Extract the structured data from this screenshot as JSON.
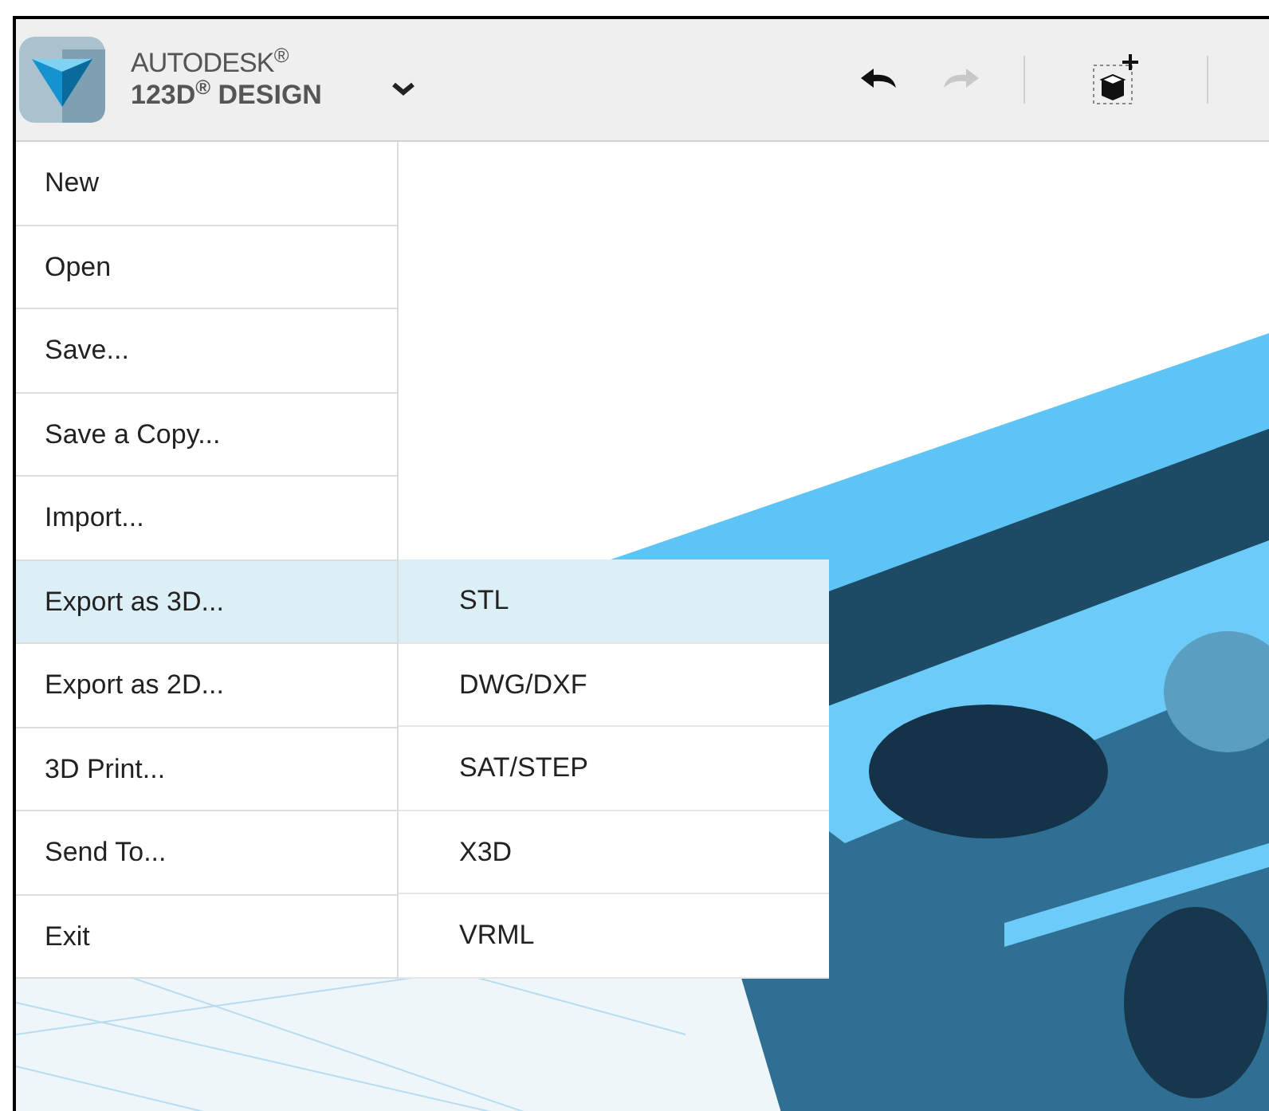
{
  "app": {
    "brand": "AUTODESK$^{®}$",
    "product": "123D$^{®}$ DESIGN"
  },
  "menu": [
    {
      "label": "New",
      "selected": false
    },
    {
      "label": "Open",
      "selected": false
    },
    {
      "label": "Save...",
      "selected": false
    },
    {
      "label": "Save a Copy...",
      "selected": false
    },
    {
      "label": "Import...",
      "selected": false
    },
    {
      "label": "Export as 3D...",
      "selected": true
    },
    {
      "label": "Export as 2D...",
      "selected": false
    },
    {
      "label": "3D Print...",
      "selected": false
    },
    {
      "label": "Send To...",
      "selected": false
    },
    {
      "label": "Exit",
      "selected": false
    }
  ],
  "submenu": [
    {
      "label": "STL",
      "selected": true
    },
    {
      "label": "DWG/DXF",
      "selected": false
    },
    {
      "label": "SAT/STEP",
      "selected": false
    },
    {
      "label": "X3D",
      "selected": false
    },
    {
      "label": "VRML",
      "selected": false
    }
  ]
}
